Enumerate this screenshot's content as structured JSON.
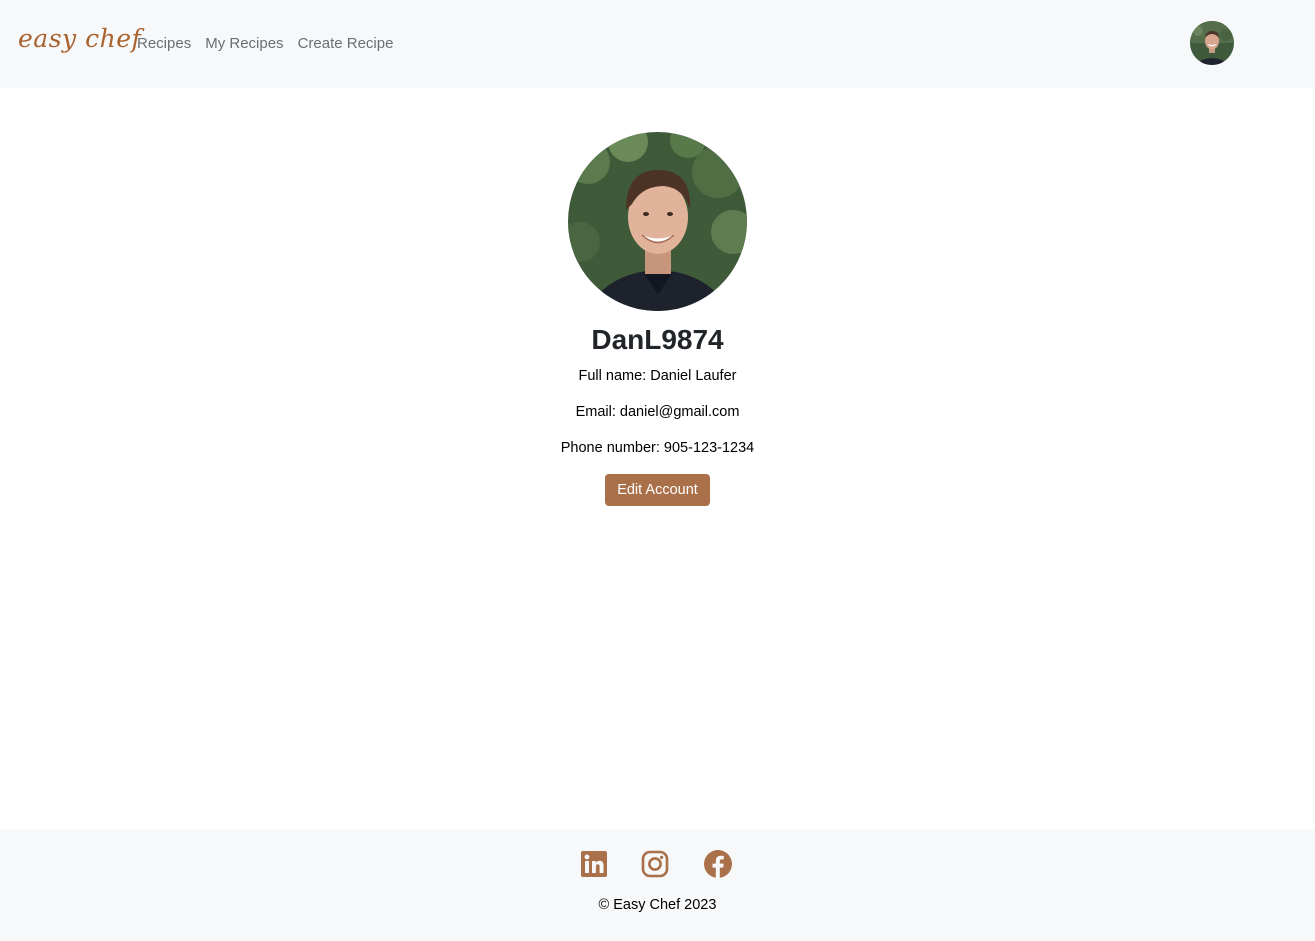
{
  "navbar": {
    "brand": "easy chef",
    "links": [
      {
        "label": "Recipes"
      },
      {
        "label": "My Recipes"
      },
      {
        "label": "Create Recipe"
      }
    ],
    "avatar_icon": "user-avatar"
  },
  "profile": {
    "username": "DanL9874",
    "full_name": "Full name: Daniel Laufer",
    "email": "Email: daniel@gmail.com",
    "phone": "Phone number: 905-123-1234",
    "edit_button": "Edit Account"
  },
  "footer": {
    "social_icons": [
      "linkedin-icon",
      "instagram-icon",
      "facebook-icon"
    ],
    "copyright": "© Easy Chef 2023"
  },
  "colors": {
    "brand": "#a8622e",
    "accent": "#a9704a",
    "nav_bg": "#f7f8fa"
  }
}
